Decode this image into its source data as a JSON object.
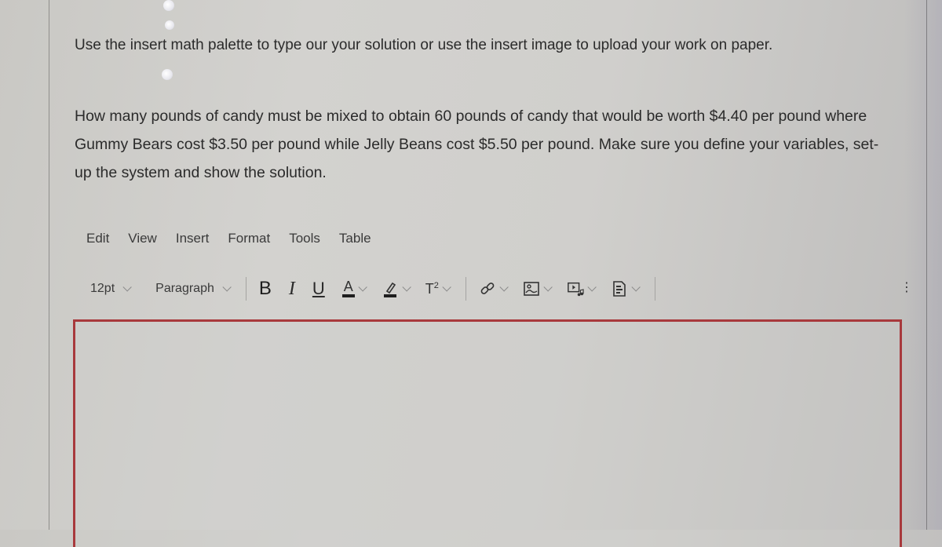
{
  "instructions": {
    "text": "Use the insert math palette to type our your solution or use the insert image to upload your work on paper."
  },
  "question": {
    "text": "How many pounds of candy must be mixed to obtain 60 pounds of candy that would be worth $4.40 per pound where Gummy Bears cost $3.50 per pound while Jelly Beans cost $5.50 per pound.  Make sure you define your variables, set-up the system and show the solution."
  },
  "editor": {
    "menubar": [
      {
        "label": "Edit"
      },
      {
        "label": "View"
      },
      {
        "label": "Insert"
      },
      {
        "label": "Format"
      },
      {
        "label": "Tools"
      },
      {
        "label": "Table"
      }
    ],
    "toolbar": {
      "font_size": "12pt",
      "block_format": "Paragraph",
      "bold": "B",
      "italic": "I",
      "underline": "U",
      "text_color": "A",
      "superscript": "T",
      "superscript_mark": "2",
      "icons": {
        "link": "link-icon",
        "image": "image-icon",
        "media": "media-icon",
        "document": "document-icon",
        "more": "more-vertical-icon"
      }
    },
    "content": "",
    "border_color": "#a8393c"
  }
}
